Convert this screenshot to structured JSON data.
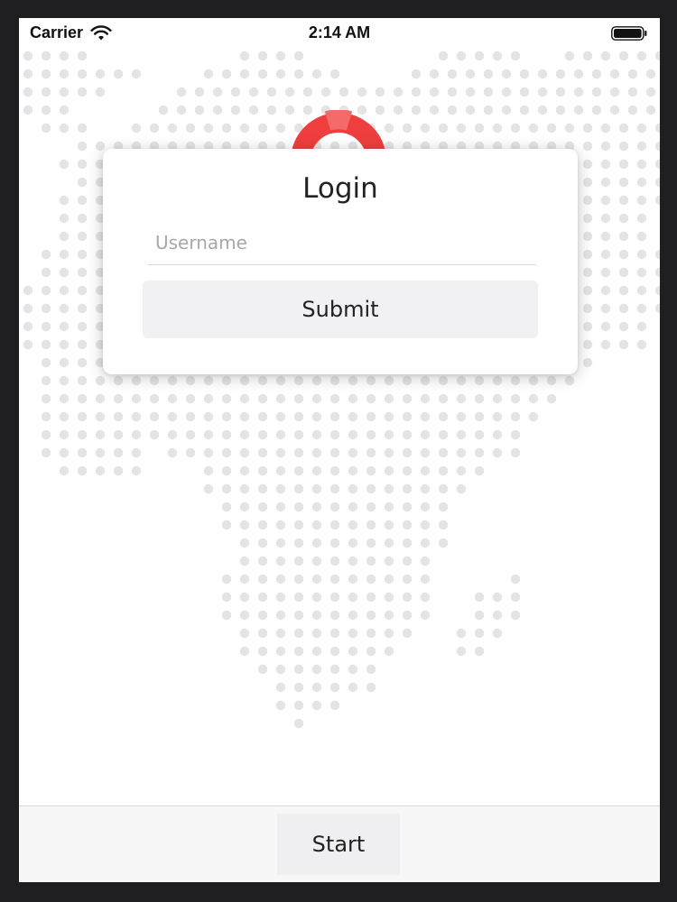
{
  "status_bar": {
    "carrier": "Carrier",
    "time": "2:14 AM",
    "wifi_icon": "wifi-icon",
    "battery_icon": "battery-icon"
  },
  "login_card": {
    "title": "Login",
    "username_placeholder": "Username",
    "username_value": "",
    "submit_label": "Submit"
  },
  "bottom_bar": {
    "start_label": "Start"
  },
  "colors": {
    "accent_red": "#ef3e3e",
    "dot_gray": "#e4e4e6",
    "button_bg": "#f1f1f3"
  }
}
